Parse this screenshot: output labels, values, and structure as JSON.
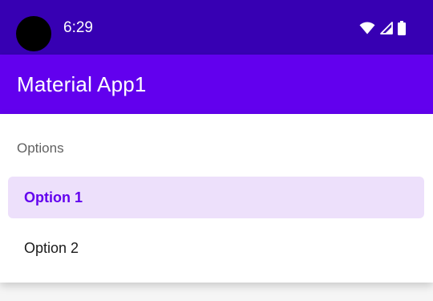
{
  "status_bar": {
    "time": "6:29",
    "icons": [
      "wifi-icon",
      "cellular-signal-icon",
      "battery-icon"
    ],
    "background": "#3700b3"
  },
  "app_bar": {
    "title": "Material App1",
    "background": "#6200ee"
  },
  "menu": {
    "section_header": "Options",
    "items": [
      {
        "label": "Option 1",
        "selected": true
      },
      {
        "label": "Option 2",
        "selected": false
      }
    ],
    "selected_color": "#6200ee",
    "selected_background": "#ede0fb"
  }
}
